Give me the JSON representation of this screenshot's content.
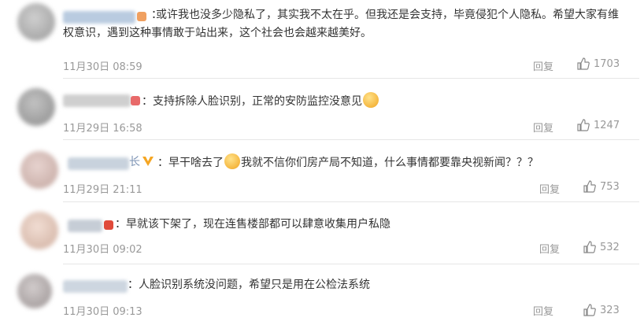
{
  "comments": [
    {
      "separator": "：",
      "text": "或许我也没多少隐私了，其实我不太在乎。但我还是会支持，毕竟侵犯个人隐私。希望大家有维权意识，遇到这种事情敢于站出来，这个社会也会越来越美好。",
      "time": "11月30日 08:59",
      "reply": "回复",
      "likes": "1703"
    },
    {
      "separator": "：",
      "text_before": "支持拆除人脸识别，正常的安防监控没意见",
      "time": "11月29日 16:58",
      "reply": "回复",
      "likes": "1247"
    },
    {
      "name_suffix": "长",
      "separator": "：",
      "text_before": "早干啥去了",
      "text_after": "我就不信你们房产局不知道，什么事情都要靠央视新闻？？？",
      "time": "11月29日 21:11",
      "reply": "回复",
      "likes": "753"
    },
    {
      "separator": "：",
      "text": "早就该下架了，现在连售楼部都可以肆意收集用户私隐",
      "time": "11月30日 09:02",
      "reply": "回复",
      "likes": "532"
    },
    {
      "separator": "：",
      "text": "人脸识别系统没问题，希望只是用在公检法系统",
      "time": "11月30日 09:13",
      "reply": "回复",
      "likes": "323"
    }
  ],
  "icons": {
    "like": "thumbs-up-icon",
    "verified": "verified-v-icon",
    "emoji": "grin-emoji-icon"
  },
  "colors": {
    "verified": "#f5a623",
    "text": "#333333",
    "meta": "#999999"
  }
}
